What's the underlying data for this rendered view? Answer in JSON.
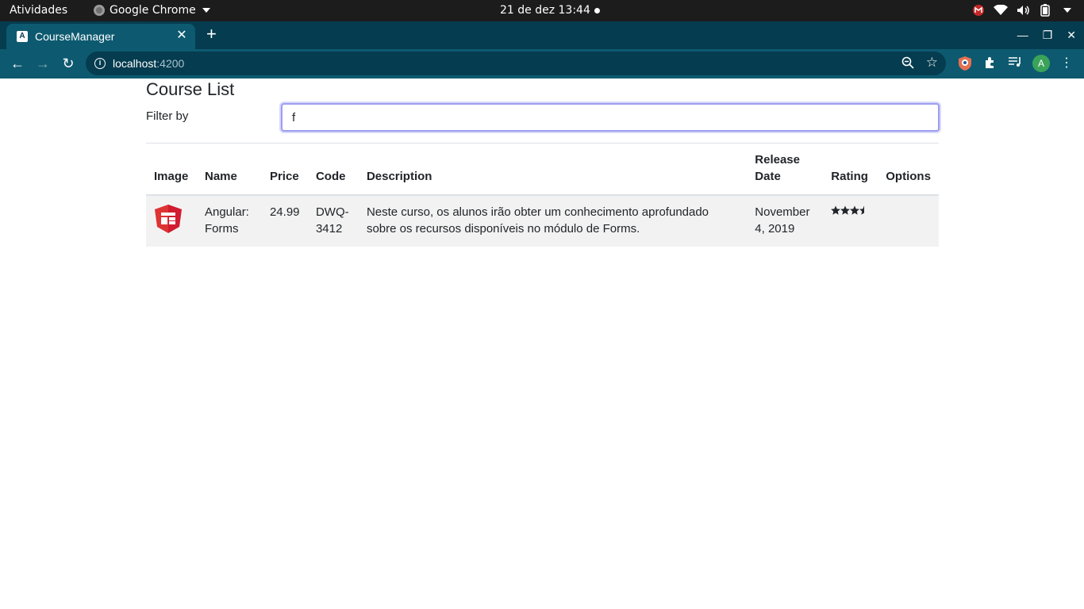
{
  "system_bar": {
    "activities": "Atividades",
    "app_name": "Google Chrome",
    "clock": "21 de dez  13:44"
  },
  "browser": {
    "tab_title": "CourseManager",
    "url_host": "localhost",
    "url_port": ":4200"
  },
  "page": {
    "title": "Course List",
    "filter_label": "Filter by",
    "filter_value": "f"
  },
  "table": {
    "headers": {
      "image": "Image",
      "name": "Name",
      "price": "Price",
      "code": "Code",
      "description": "Description",
      "release_date": "Release Date",
      "rating": "Rating",
      "options": "Options"
    },
    "rows": [
      {
        "image_icon": "angular-forms-icon",
        "name": "Angular: Forms",
        "price": "24.99",
        "code": "DWQ-3412",
        "description": "Neste curso, os alunos irão obter um conhecimento aprofundado sobre os recursos disponíveis no módulo de Forms.",
        "release_date": "November 4, 2019",
        "rating": 3.5,
        "options": ""
      }
    ]
  },
  "colors": {
    "accent_tab": "#0d5a70",
    "tabstrip": "#053c4f",
    "row_bg": "#f2f2f2",
    "angular_red": "#dd3333"
  }
}
